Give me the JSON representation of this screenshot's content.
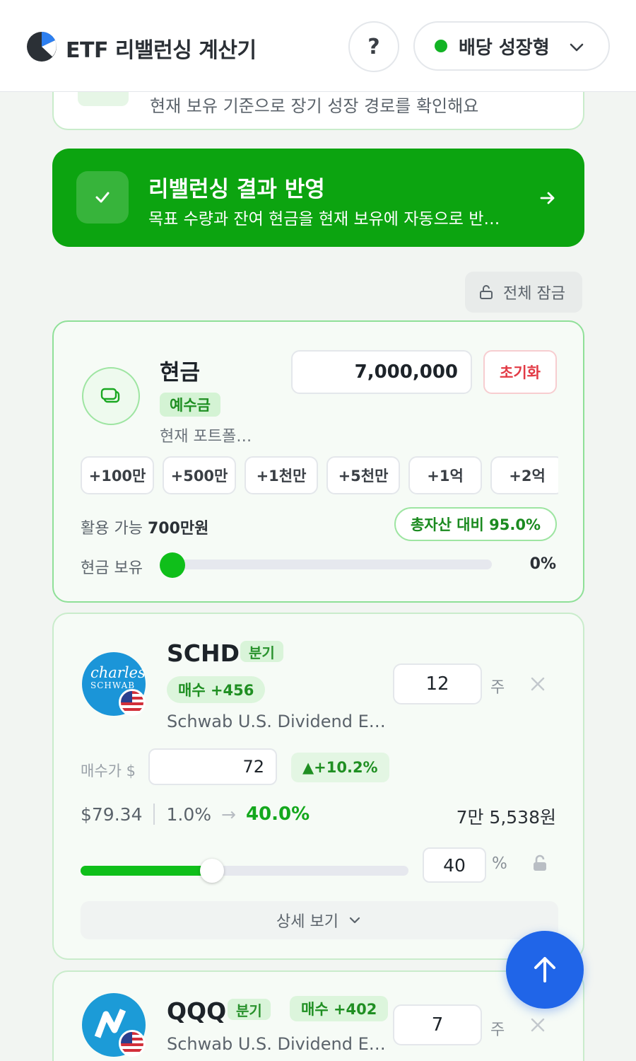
{
  "header": {
    "app_title": "ETF 리밸런싱 계산기",
    "help_label": "?",
    "profile": "배당 성장형"
  },
  "prev_card": {
    "subtitle": "현재 보유 기준으로 장기 성장 경로를 확인해요"
  },
  "apply_banner": {
    "title": "리밸런싱 결과 반영",
    "subtitle": "목표 수량과 잔여 현금을 현재 보유에 자동으로 반영해요"
  },
  "lock_all_label": "전체 잠금",
  "cash": {
    "title": "현금",
    "badge": "예수금",
    "description": "현재 포트폴…",
    "amount": "7,000,000",
    "reset_label": "초기화",
    "quick_add": [
      "+100만",
      "+500만",
      "+1천만",
      "+5천만",
      "+1억",
      "+2억"
    ],
    "available_prefix": "활용 가능",
    "available_value": "700만원",
    "ratio_label": "총자산 대비 95.0%",
    "hold_label": "현금 보유",
    "hold_pct": "0%",
    "hold_value": 0
  },
  "etfs": [
    {
      "ticker": "SCHD",
      "dividend_freq": "분기",
      "buy_tag": "매수 +456",
      "name": "Schwab U.S. Dividend E…",
      "quantity": "12",
      "unit": "주",
      "buy_price_label": "매수가 $",
      "buy_price": "72",
      "gain": "▲+10.2%",
      "price": "$79.34",
      "current_weight": "1.0%",
      "target_weight": "40.0%",
      "amount": "7만 5,538원",
      "weight_input": "40",
      "weight_unit": "%",
      "weight_value": 40,
      "details_label": "상세 보기",
      "logo_text": "charles",
      "logo_sub": "SCHWAB"
    },
    {
      "ticker": "QQQ",
      "dividend_freq": "분기",
      "buy_tag": "매수 +402",
      "name": "Schwab U.S. Dividend E…",
      "quantity": "7",
      "unit": "주"
    }
  ],
  "colors": {
    "accent_green": "#0ca410",
    "slider_green": "#0fbf1a",
    "danger": "#e23a45",
    "scroll_top": "#2065e8"
  },
  "icons": {
    "logo": "pie-logo-icon",
    "help": "question-icon",
    "chevron": "chevron-down-icon",
    "check": "check-icon",
    "arrow": "arrow-right-icon",
    "lock": "lock-open-icon",
    "cash": "cash-icon",
    "close": "close-icon",
    "scroll_top": "arrow-up-icon"
  }
}
